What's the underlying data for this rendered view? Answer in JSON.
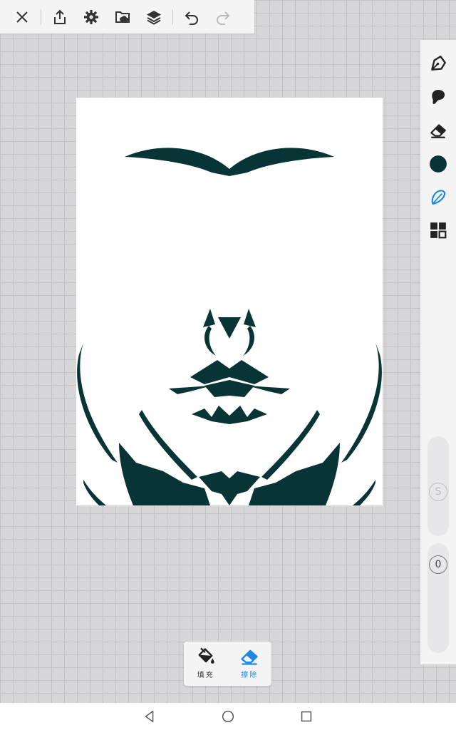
{
  "toolbar": {
    "icons": [
      "close-icon",
      "share-icon",
      "gear-icon",
      "folder-cloud-icon",
      "layers-icon",
      "undo-icon",
      "redo-icon"
    ]
  },
  "right_toolbar": {
    "icons": [
      "pen-icon",
      "smudge-icon",
      "eraser-icon",
      "color-swatch",
      "lasso-icon",
      "grid-tools-icon"
    ],
    "current_color": "#093435",
    "size_slider_label": "S",
    "opacity_slider_label": "0"
  },
  "canvas": {
    "ink_color": "#093435",
    "background": "#ffffff"
  },
  "mode_popup": {
    "fill_label": "填充",
    "erase_label": "擦除",
    "active_color": "#1e88e5"
  },
  "nav": {
    "icons": [
      "back-icon",
      "home-icon",
      "recents-icon"
    ]
  }
}
